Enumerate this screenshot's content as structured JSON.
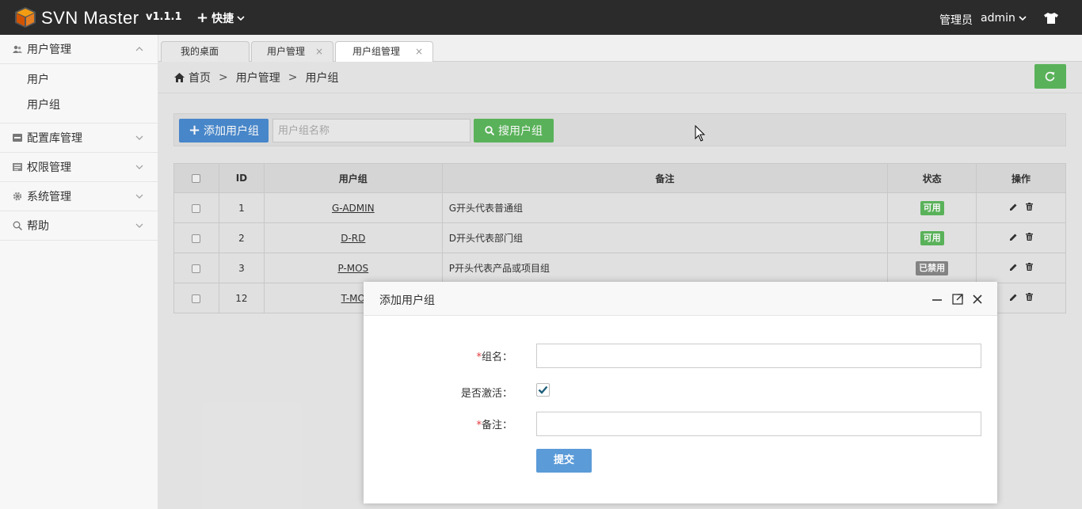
{
  "header": {
    "app_name": "SVN Master",
    "version": "v1.1.1",
    "quick_label": "快捷",
    "role_label": "管理员",
    "username": "admin"
  },
  "sidebar": {
    "items": [
      {
        "label": "用户管理",
        "expanded": true,
        "icon": "users-icon",
        "children": [
          {
            "label": "用户"
          },
          {
            "label": "用户组"
          }
        ]
      },
      {
        "label": "配置库管理",
        "icon": "repository-icon"
      },
      {
        "label": "权限管理",
        "icon": "permission-icon"
      },
      {
        "label": "系统管理",
        "icon": "gear-icon"
      },
      {
        "label": "帮助",
        "icon": "search-icon"
      }
    ]
  },
  "tabs": [
    {
      "label": "我的桌面"
    },
    {
      "label": "用户管理",
      "close": "×"
    },
    {
      "label": "用户组管理",
      "close": "×",
      "active": true
    }
  ],
  "breadcrumb": {
    "home": "首页",
    "sep": ">",
    "level1": "用户管理",
    "level2": "用户组"
  },
  "toolbar": {
    "add_label": "添加用户组",
    "search_placeholder": "用户组名称",
    "search_label": "搜用户组"
  },
  "table": {
    "headers": [
      "ID",
      "用户组",
      "备注",
      "状态",
      "操作"
    ],
    "rows": [
      {
        "id": "1",
        "name": "G-ADMIN",
        "note": "G开头代表普通组",
        "status": "可用",
        "enabled": true
      },
      {
        "id": "2",
        "name": "D-RD",
        "note": "D开头代表部门组",
        "status": "可用",
        "enabled": true
      },
      {
        "id": "3",
        "name": "P-MOS",
        "note": "P开头代表产品或项目组",
        "status": "已禁用",
        "enabled": false
      },
      {
        "id": "12",
        "name": "T-MO",
        "note": "",
        "status": "",
        "enabled": null
      }
    ]
  },
  "modal": {
    "title": "添加用户组",
    "required_mark": "*",
    "group_name_label": "组名：",
    "active_label": "是否激活：",
    "active_checked": true,
    "note_label": "备注：",
    "submit_label": "提交"
  },
  "colors": {
    "topbar": "#2b2b2b",
    "primary": "#4a8bd0",
    "success": "#5cb85c",
    "disabled": "#888888",
    "required": "#e4393c"
  }
}
